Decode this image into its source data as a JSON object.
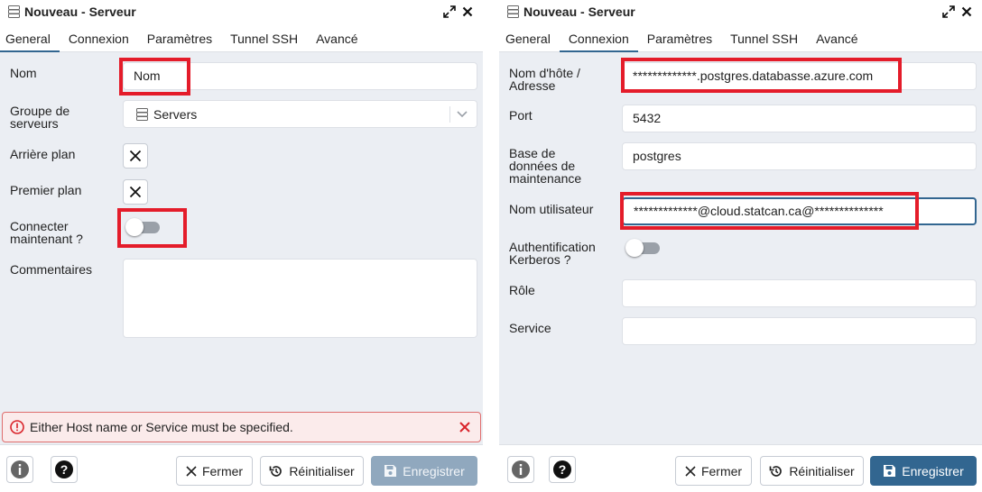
{
  "left": {
    "title": "Nouveau - Serveur",
    "tabs": [
      "General",
      "Connexion",
      "Paramètres",
      "Tunnel SSH",
      "Avancé"
    ],
    "active_tab": "General",
    "fields": {
      "nom_label": "Nom",
      "nom_value": "Nom",
      "groupe_label": "Groupe de serveurs",
      "groupe_value": "Servers",
      "arriere_label": "Arrière plan",
      "premier_label": "Premier plan",
      "connecter_label": "Connecter maintenant ?",
      "connecter_value": false,
      "commentaires_label": "Commentaires",
      "commentaires_value": ""
    },
    "alert": {
      "text": "Either Host name or Service must be specified."
    },
    "footer": {
      "close": "Fermer",
      "reset": "Réinitialiser",
      "save": "Enregistrer",
      "save_disabled": true
    }
  },
  "right": {
    "title": "Nouveau - Serveur",
    "tabs": [
      "General",
      "Connexion",
      "Paramètres",
      "Tunnel SSH",
      "Avancé"
    ],
    "active_tab": "Connexion",
    "fields": {
      "host_label": "Nom d'hôte / Adresse",
      "host_value": "*************.postgres.databasse.azure.com",
      "port_label": "Port",
      "port_value": "5432",
      "db_label": "Base de données de maintenance",
      "db_value": "postgres",
      "user_label": "Nom utilisateur",
      "user_value": "*************@cloud.statcan.ca@**************",
      "kerberos_label": "Authentification Kerberos ?",
      "kerberos_value": false,
      "role_label": "Rôle",
      "role_value": "",
      "service_label": "Service",
      "service_value": ""
    },
    "footer": {
      "close": "Fermer",
      "reset": "Réinitialiser",
      "save": "Enregistrer",
      "save_disabled": false
    }
  },
  "colors": {
    "accent": "#326690",
    "highlight": "#e41c2a",
    "body_bg": "#ebeef3",
    "error": "#d9232a"
  },
  "icons": [
    "server-icon",
    "expand-icon",
    "close-icon",
    "x-icon",
    "chevron-down-icon",
    "error-icon",
    "info-icon",
    "help-icon",
    "reset-icon",
    "save-icon"
  ]
}
